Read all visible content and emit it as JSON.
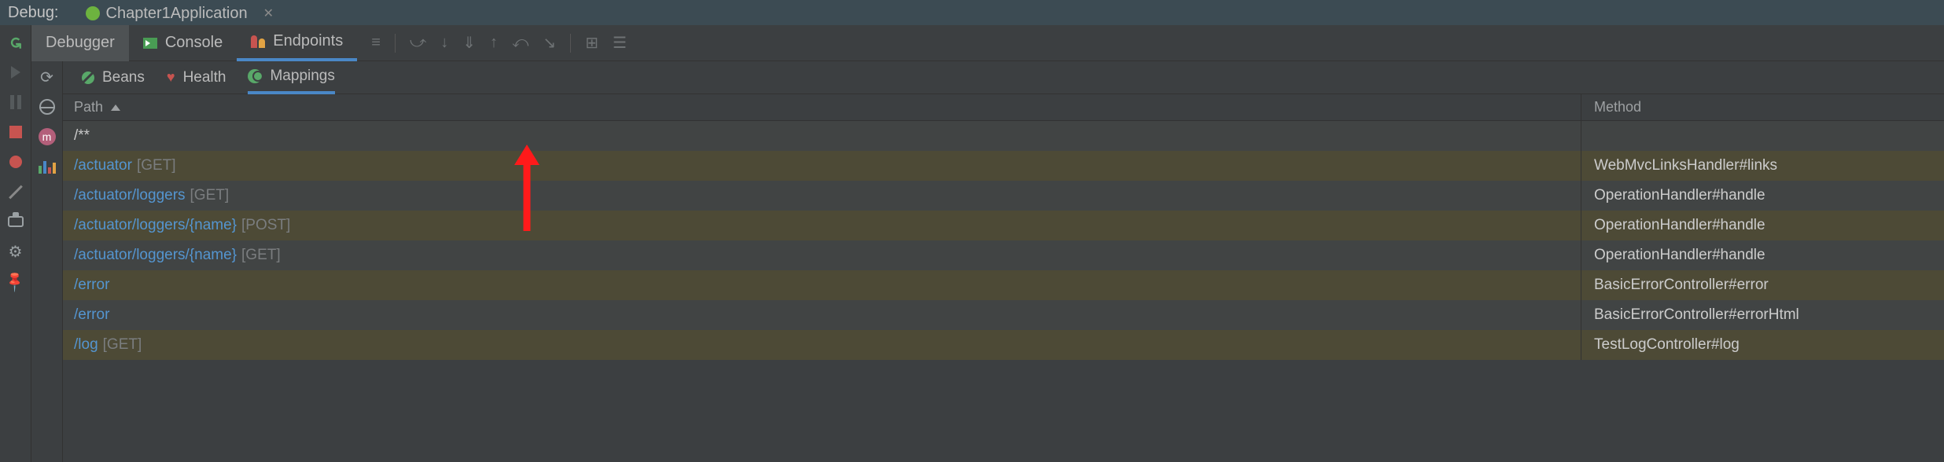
{
  "header": {
    "debug_label": "Debug:",
    "run_config": "Chapter1Application"
  },
  "tool_tabs": {
    "debugger": "Debugger",
    "console": "Console",
    "endpoints": "Endpoints"
  },
  "sub_tabs": {
    "beans": "Beans",
    "health": "Health",
    "mappings": "Mappings"
  },
  "columns": {
    "path": "Path",
    "method": "Method"
  },
  "rows": [
    {
      "path": "/**",
      "http": "",
      "method": "",
      "highlight": false,
      "star": true
    },
    {
      "path": "/actuator",
      "http": "[GET]",
      "method": "WebMvcLinksHandler#links",
      "highlight": true
    },
    {
      "path": "/actuator/loggers",
      "http": "[GET]",
      "method": "OperationHandler#handle",
      "highlight": false
    },
    {
      "path": "/actuator/loggers/{name}",
      "http": "[POST]",
      "method": "OperationHandler#handle",
      "highlight": true
    },
    {
      "path": "/actuator/loggers/{name}",
      "http": "[GET]",
      "method": "OperationHandler#handle",
      "highlight": false
    },
    {
      "path": "/error",
      "http": "",
      "method": "BasicErrorController#error",
      "highlight": true
    },
    {
      "path": "/error",
      "http": "",
      "method": "BasicErrorController#errorHtml",
      "highlight": false
    },
    {
      "path": "/log",
      "http": "[GET]",
      "method": "TestLogController#log",
      "highlight": true
    }
  ]
}
